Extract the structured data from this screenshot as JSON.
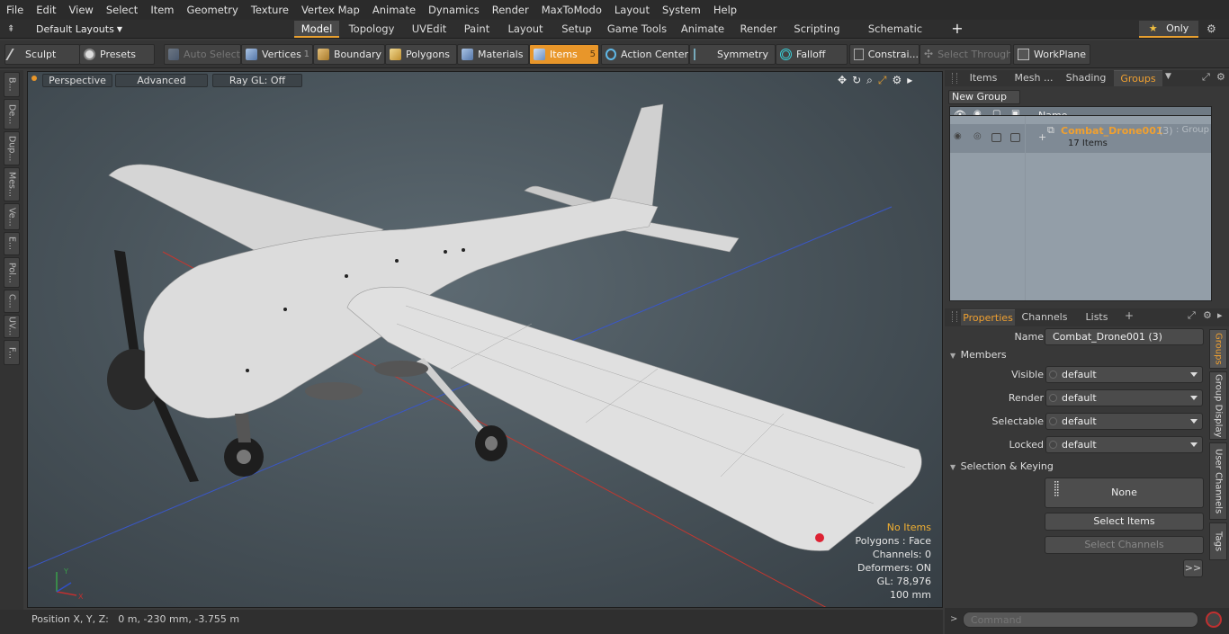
{
  "menu": [
    "File",
    "Edit",
    "View",
    "Select",
    "Item",
    "Geometry",
    "Texture",
    "Vertex Map",
    "Animate",
    "Dynamics",
    "Render",
    "MaxToModo",
    "Layout",
    "System",
    "Help"
  ],
  "layouts_label": "Default Layouts",
  "mode_tabs": [
    "Model",
    "Topology",
    "UVEdit",
    "Paint",
    "Layout",
    "Setup",
    "Game Tools",
    "Animate",
    "Render",
    "Scripting",
    "Schematic Fusion"
  ],
  "mode_tab_active": "Model",
  "only_label": "Only",
  "toolbar": {
    "sculpt": "Sculpt",
    "presets": "Presets",
    "auto_select": "Auto Select",
    "vertices": "Vertices",
    "vertices_count": "1",
    "boundary": "Boundary",
    "polygons": "Polygons",
    "materials": "Materials",
    "items": "Items",
    "items_count": "5",
    "action_center": "Action Center",
    "symmetry": "Symmetry",
    "falloff": "Falloff",
    "constraints": "Constrai...",
    "select_through": "Select Through",
    "workplane": "WorkPlane"
  },
  "left_tabs": [
    "B...",
    "De...",
    "Dup...",
    "Mes...",
    "Ve...",
    "E...",
    "Pol...",
    "C...",
    "UV...",
    "F..."
  ],
  "viewport": {
    "perspective": "Perspective",
    "advanced": "Advanced",
    "raygl": "Ray GL: Off",
    "stats": {
      "items": "No Items",
      "polygons": "Polygons : Face",
      "channels": "Channels: 0",
      "deformers": "Deformers: ON",
      "gl": "GL: 78,976",
      "scale": "100 mm"
    },
    "axis_x": "X",
    "axis_y": "Y"
  },
  "status": "Position X, Y, Z:   0 m, -230 mm, -3.755 m",
  "panel_tabs": [
    "Items",
    "Mesh ...",
    "Shading",
    "Groups"
  ],
  "panel_tab_active": "Groups",
  "new_group": "New Group",
  "group_col_name": "Name",
  "group": {
    "name": "Combat_Drone001",
    "count": "(3)",
    "type": ": Group",
    "items": "17 Items"
  },
  "prop_tabs": [
    "Properties",
    "Channels",
    "Lists"
  ],
  "prop_tab_active": "Properties",
  "props": {
    "name_label": "Name",
    "name_value": "Combat_Drone001 (3)",
    "members": "Members",
    "visible_label": "Visible",
    "render_label": "Render",
    "selectable_label": "Selectable",
    "locked_label": "Locked",
    "dd_value": "default",
    "sel_keying": "Selection & Keying",
    "none": "None",
    "select_items": "Select Items",
    "select_channels": "Select Channels",
    "more": ">>"
  },
  "vertical_tabs": [
    "Groups",
    "Group Display",
    "User Channels",
    "Tags"
  ],
  "command_placeholder": "Command",
  "colors": {
    "accent": "#e8962a",
    "group_name": "#f0a030"
  }
}
